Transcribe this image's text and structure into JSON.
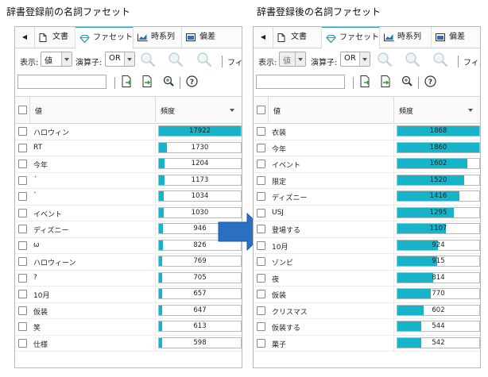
{
  "captions": {
    "before": "辞書登録前の名詞ファセット",
    "after": "辞書登録後の名詞ファセット"
  },
  "tabs": {
    "document": "文書",
    "facet": "ファセット",
    "timeseries": "時系列",
    "deviation": "偏差"
  },
  "toolbar": {
    "display_label": "表示:",
    "display_value": "値",
    "operator_label": "演算子:",
    "operator_value": "OR",
    "filter_label": "フィル"
  },
  "columns": {
    "value": "値",
    "frequency": "頻度"
  },
  "colors": {
    "bar": "#17b3c9",
    "arrow": "#2a6fc1"
  },
  "before": {
    "max": 17922,
    "rows": [
      {
        "name": "ハロウィン",
        "value": 17922
      },
      {
        "name": "RT",
        "value": 1730
      },
      {
        "name": "今年",
        "value": 1204
      },
      {
        "name": "´",
        "value": 1173
      },
      {
        "name": "`",
        "value": 1034
      },
      {
        "name": "イベント",
        "value": 1030
      },
      {
        "name": "ディズニー",
        "value": 946
      },
      {
        "name": "ω",
        "value": 826
      },
      {
        "name": "ハロウィーン",
        "value": 769
      },
      {
        "name": "?",
        "value": 705
      },
      {
        "name": "10月",
        "value": 657
      },
      {
        "name": "仮装",
        "value": 647
      },
      {
        "name": "笑",
        "value": 613
      },
      {
        "name": "仕様",
        "value": 598
      }
    ]
  },
  "after": {
    "max": 1868,
    "rows": [
      {
        "name": "衣装",
        "value": 1868
      },
      {
        "name": "今年",
        "value": 1860
      },
      {
        "name": "イベント",
        "value": 1602
      },
      {
        "name": "限定",
        "value": 1520
      },
      {
        "name": "ディズニー",
        "value": 1416
      },
      {
        "name": "USJ",
        "value": 1295
      },
      {
        "name": "登場する",
        "value": 1107
      },
      {
        "name": "10月",
        "value": 924
      },
      {
        "name": "ゾンビ",
        "value": 915
      },
      {
        "name": "夜",
        "value": 814
      },
      {
        "name": "仮装",
        "value": 770
      },
      {
        "name": "クリスマス",
        "value": 602
      },
      {
        "name": "仮装する",
        "value": 544
      },
      {
        "name": "菓子",
        "value": 542
      }
    ]
  }
}
